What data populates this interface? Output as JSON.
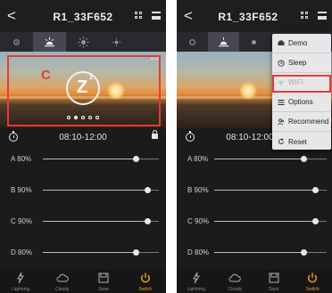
{
  "left": {
    "header": {
      "back_glyph": "<",
      "title": "R1_33F652"
    },
    "mode_icons": [
      "moon-stars-icon",
      "sunrise-icon",
      "sun-icon",
      "sun-small-icon",
      "moon-icon"
    ],
    "active_mode_index": 1,
    "photo": {
      "time": "11:07",
      "annotation": "C",
      "dot_count": 5,
      "active_dot": 1
    },
    "timer": {
      "time_range": "08:10-12:00"
    },
    "channels": [
      {
        "label": "A  80%",
        "level": 0.8
      },
      {
        "label": "B  90%",
        "level": 0.9
      },
      {
        "label": "C  90%",
        "level": 0.9
      },
      {
        "label": "D  80%",
        "level": 0.8
      }
    ],
    "tabs": [
      {
        "label": "Lightning",
        "icon": "lightning-icon"
      },
      {
        "label": "Cloudy",
        "icon": "cloud-icon"
      },
      {
        "label": "Save",
        "icon": "save-icon"
      },
      {
        "label": "Switch",
        "icon": "power-icon"
      }
    ],
    "active_tab_index": 3
  },
  "right": {
    "header": {
      "back_glyph": "<",
      "title": "R1_33F652"
    },
    "timer": {
      "time_range": "08:10-12:00"
    },
    "channels": [
      {
        "label": "A  80%",
        "level": 0.8
      },
      {
        "label": "B  90%",
        "level": 0.9
      },
      {
        "label": "C  90%",
        "level": 0.9
      },
      {
        "label": "D  80%",
        "level": 0.8
      }
    ],
    "tabs": [
      {
        "label": "Lightning",
        "icon": "lightning-icon"
      },
      {
        "label": "Cloudy",
        "icon": "cloud-icon"
      },
      {
        "label": "Save",
        "icon": "save-icon"
      },
      {
        "label": "Switch",
        "icon": "power-icon"
      }
    ],
    "active_tab_index": 3,
    "menu": [
      {
        "label": "Demo",
        "icon": "demo-icon"
      },
      {
        "label": "Sleep",
        "icon": "clock-icon"
      },
      {
        "label": "WIFI",
        "icon": "wifi-icon"
      },
      {
        "label": "Options",
        "icon": "list-icon"
      },
      {
        "label": "Recommend",
        "icon": "users-icon"
      },
      {
        "label": "Reset",
        "icon": "reset-icon"
      }
    ]
  },
  "colors": {
    "accent": "#f0a020",
    "annotation_red": "#e53b3b",
    "bg": "#1b1b1d"
  }
}
